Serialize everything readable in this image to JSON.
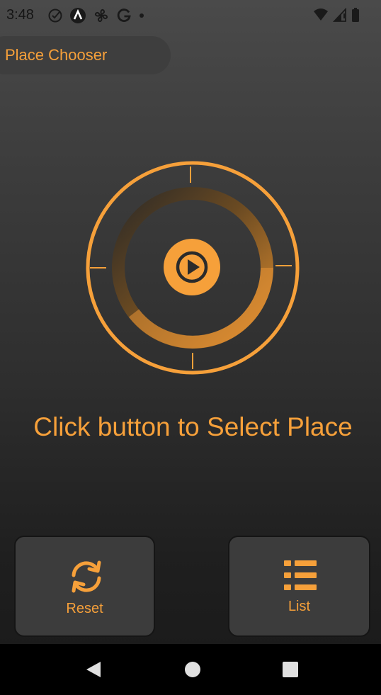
{
  "status_bar": {
    "time": "3:48",
    "left_icons": [
      "check-circle-icon",
      "app-a-icon",
      "fan-icon",
      "google-g-icon",
      "dot-icon"
    ],
    "right_icons": [
      "wifi-icon",
      "signal-icon",
      "battery-icon"
    ]
  },
  "app_bar": {
    "title": "Place Chooser"
  },
  "dial": {
    "accent_color": "#f6a03a",
    "icon": "play-icon"
  },
  "main": {
    "prompt": "Click button to Select Place"
  },
  "buttons": {
    "reset": {
      "label": "Reset",
      "icon": "refresh-icon"
    },
    "list": {
      "label": "List",
      "icon": "list-icon"
    }
  },
  "nav_bar": {
    "items": [
      "back-icon",
      "home-icon",
      "recents-icon"
    ]
  },
  "colors": {
    "accent": "#f6a03a",
    "background_top": "#4a4a4a",
    "background_bottom": "#191919",
    "button_bg": "#3c3c3c"
  }
}
